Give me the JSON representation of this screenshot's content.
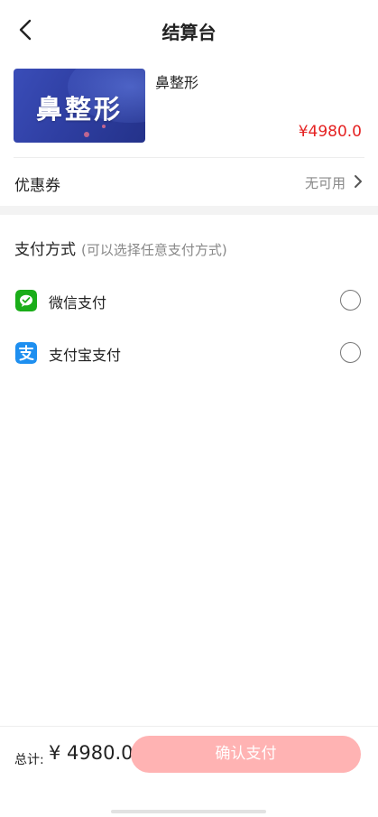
{
  "header": {
    "title": "结算台"
  },
  "product": {
    "image_text": "鼻整形",
    "name": "鼻整形",
    "price": "¥4980.0"
  },
  "coupon": {
    "label": "优惠券",
    "value": "无可用"
  },
  "payment": {
    "title": "支付方式",
    "hint": "(可以选择任意支付方式)",
    "methods": [
      {
        "label": "微信支付",
        "icon": "wechat-pay-icon",
        "color": "#1aad19",
        "selected": false
      },
      {
        "label": "支付宝支付",
        "icon": "alipay-icon",
        "color": "#1e8ff0",
        "selected": false
      }
    ]
  },
  "footer": {
    "total_label": "总计:",
    "total_amount": "¥ 4980.0",
    "confirm_label": "确认支付"
  },
  "colors": {
    "price": "#e52222",
    "confirm_button": "#ffb3b3",
    "thumbnail": "#2f3fa3"
  }
}
